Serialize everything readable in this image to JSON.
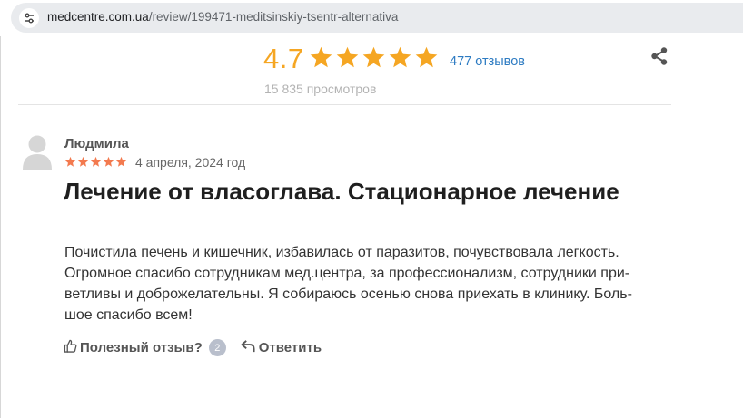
{
  "browser": {
    "url_host": "medcentre.com.ua",
    "url_path": "/review/199471-meditsinskiy-tsentr-alternativa"
  },
  "summary": {
    "rating": "4.7",
    "stars_filled": 5,
    "star_color": "#f5a623",
    "reviews_count_label": "477 отзывов",
    "views_label": "15 835 просмотров"
  },
  "review": {
    "author": "Людмила",
    "stars": 5,
    "star_color": "#f37a4f",
    "date": "4 апреля, 2024 год",
    "title": "Лечение от власоглава. Стационарное лечение",
    "body": "Почистила печень и кишечник, избавилась от паразитов, почувствовала легкость.\nОгромное спасибо сотрудникам мед.центра, за профессионализм, сотрудники при-\nветливы и доброжелательны. Я собираюсь осенью снова приехать в клинику. Боль-\nшое спасибо всем!"
  },
  "actions": {
    "helpful_label": "Полезный отзыв?",
    "helpful_count": "2",
    "reply_label": "Ответить"
  },
  "icons": {
    "site_info": "site-info-icon",
    "share": "share-icon",
    "avatar": "user-avatar-icon",
    "thumbs_up": "thumbs-up-icon",
    "reply": "reply-arrow-icon"
  }
}
